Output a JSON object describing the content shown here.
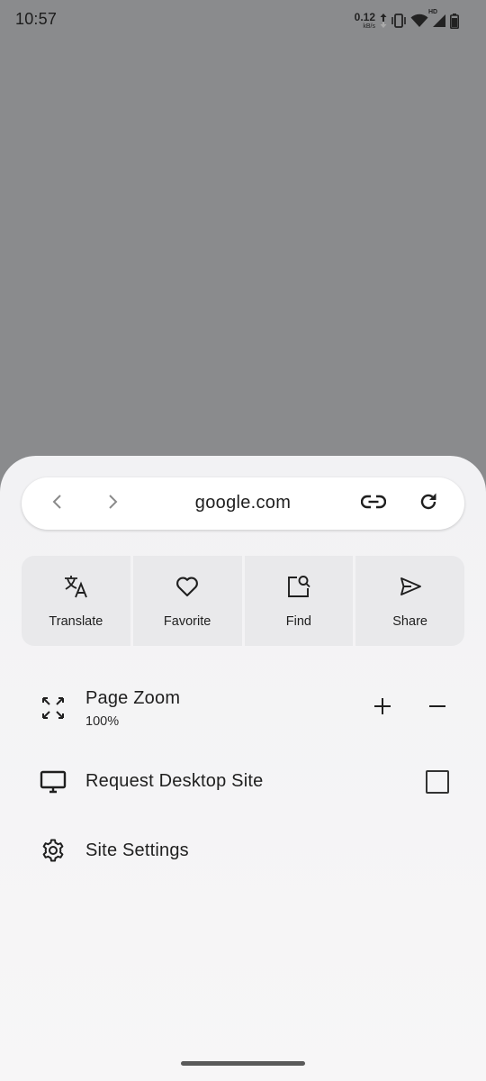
{
  "status_bar": {
    "time": "10:57",
    "net_speed_value": "0.12",
    "net_speed_unit": "kB/s",
    "network_badge": "HD",
    "icons": [
      "upload-arrow-icon",
      "vibrate-icon",
      "wifi-icon",
      "signal-icon",
      "battery-icon"
    ]
  },
  "url_bar": {
    "url": "google.com",
    "buttons": [
      "back-icon",
      "forward-icon",
      "link-icon",
      "refresh-icon"
    ]
  },
  "actions": [
    {
      "label": "Translate",
      "icon": "translate-icon"
    },
    {
      "label": "Favorite",
      "icon": "heart-icon"
    },
    {
      "label": "Find",
      "icon": "find-icon"
    },
    {
      "label": "Share",
      "icon": "send-icon"
    }
  ],
  "menu": {
    "page_zoom": {
      "title": "Page Zoom",
      "value": "100%",
      "icon": "zoom-expand-icon"
    },
    "request_desktop": {
      "title": "Request Desktop Site",
      "icon": "monitor-icon",
      "checked": false
    },
    "site_settings": {
      "title": "Site Settings",
      "icon": "gear-icon"
    }
  },
  "colors": {
    "scrim": "#8a8b8d",
    "sheet": "#f2f2f4",
    "tile": "#e9e9eb",
    "text": "#1f1f1f"
  }
}
